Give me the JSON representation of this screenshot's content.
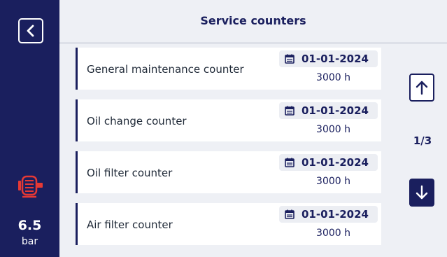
{
  "header": {
    "title": "Service counters"
  },
  "sidebar": {
    "back_icon": "chevron-left-icon",
    "status_icon": "motor-icon",
    "status_icon_color": "#e53935",
    "pressure": {
      "value": "6.5",
      "unit": "bar"
    }
  },
  "counters": [
    {
      "label": "General maintenance counter",
      "date": "01-01-2024",
      "hours": "3000 h"
    },
    {
      "label": "Oil change counter",
      "date": "01-01-2024",
      "hours": "3000 h"
    },
    {
      "label": "Oil filter counter",
      "date": "01-01-2024",
      "hours": "3000 h"
    },
    {
      "label": "Air filter counter",
      "date": "01-01-2024",
      "hours": "3000 h"
    }
  ],
  "pagination": {
    "indicator": "1/3",
    "up_icon": "arrow-up-icon",
    "down_icon": "arrow-down-icon"
  },
  "colors": {
    "primary": "#1a1f5e",
    "background": "#eef0f5",
    "accent": "#e53935"
  }
}
